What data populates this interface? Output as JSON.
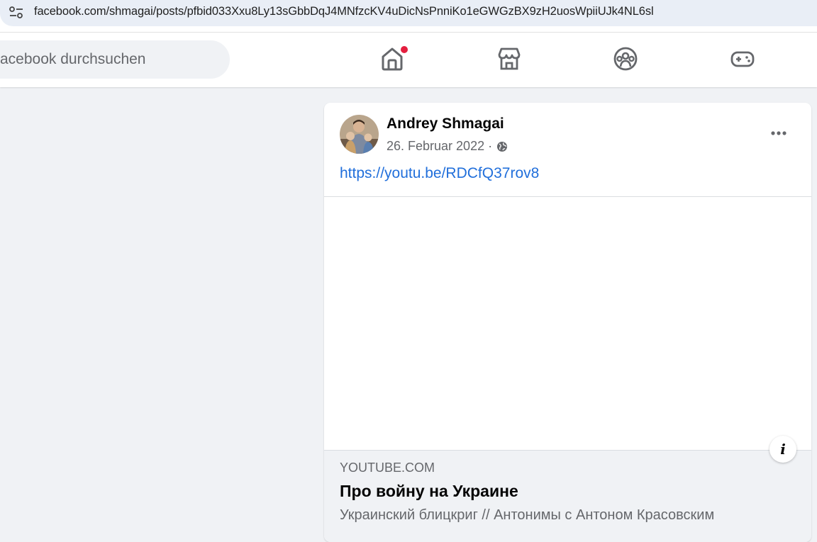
{
  "browser": {
    "url": "facebook.com/shmagai/posts/pfbid033Xxu8Ly13sGbbDqJ4MNfzcKV4uDicNsPnniKo1eGWGzBX9zH2uosWpiiUJk4NL6sl",
    "site_info_icon": "tune-icon"
  },
  "header": {
    "search_placeholder": "acebook durchsuchen",
    "nav": [
      {
        "icon": "home-icon",
        "active": false,
        "notification": true
      },
      {
        "icon": "marketplace-icon",
        "active": false
      },
      {
        "icon": "groups-icon",
        "active": false
      },
      {
        "icon": "gaming-icon",
        "active": false
      }
    ],
    "notification_color": "#e41e3f"
  },
  "post": {
    "author": "Andrey Shmagai",
    "date": "26. Februar 2022 ·",
    "privacy_icon": "globe-icon",
    "more_icon": "more-horizontal-icon",
    "link_text": "https://youtu.be/RDCfQ37rov8",
    "link_color": "#216fdb",
    "preview": {
      "domain": "YOUTUBE.COM",
      "title": "Про войну на Украине",
      "description": "Украинский блицкриг // Антонимы с Антоном Красовским"
    },
    "info_button_label": "i"
  }
}
